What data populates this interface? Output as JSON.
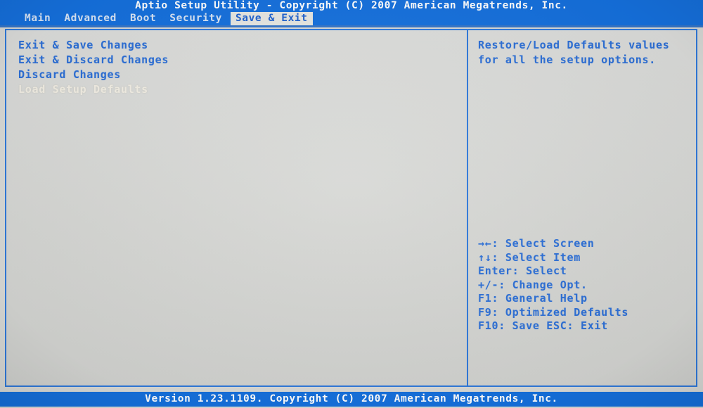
{
  "title": "Aptio Setup Utility - Copyright (C) 2007 American Megatrends, Inc.",
  "menubar": {
    "tabs": [
      {
        "label": "Main",
        "selected": false
      },
      {
        "label": "Advanced",
        "selected": false
      },
      {
        "label": "Boot",
        "selected": false
      },
      {
        "label": "Security",
        "selected": false
      },
      {
        "label": "Save & Exit",
        "selected": true
      }
    ]
  },
  "options": [
    {
      "label": "Exit & Save Changes",
      "highlighted": false
    },
    {
      "label": "Exit & Discard Changes",
      "highlighted": false
    },
    {
      "label": "Discard Changes",
      "highlighted": false
    },
    {
      "label": "Load Setup Defaults",
      "highlighted": true
    }
  ],
  "help": {
    "lines": [
      "Restore/Load Defaults values",
      "for all the setup options."
    ]
  },
  "key_legend": [
    "→←: Select Screen",
    "↑↓: Select Item",
    "Enter: Select",
    "+/-: Change Opt.",
    "F1: General Help",
    "F9: Optimized Defaults",
    "F10: Save  ESC: Exit"
  ],
  "footer": "Version 1.23.1109. Copyright (C) 2007 American Megatrends, Inc.",
  "colors": {
    "bios_blue": "#1570dd",
    "text_blue": "#2d6fd6",
    "panel_gray": "#d9dad7",
    "highlight_text": "#f2eee4",
    "tab_selected_bg": "#e6e7e2"
  }
}
